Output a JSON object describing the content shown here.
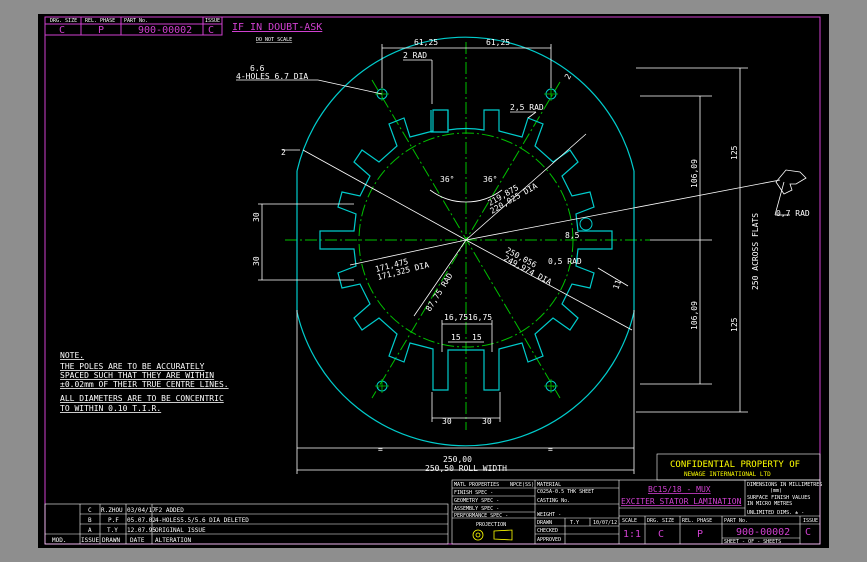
{
  "header": {
    "col_labels": [
      "DRG. SIZE",
      "REL. PHASE",
      "PART No.",
      "ISSUE"
    ],
    "drg_size": "C",
    "rel_phase": "P",
    "part_no": "900-00002",
    "issue": "C",
    "doubt": "IF IN DOUBT-ASK",
    "noscale": "DO NOT SCALE"
  },
  "dims": {
    "w61a": "61,25",
    "w61b": "61,25",
    "rad2_top": "2 RAD",
    "rad2_5": "2,5 RAD",
    "dia66": "6.6",
    "holes": "4-HOLES 6.7 DIA",
    "left2": "2",
    "top2": "2",
    "h30a": "30",
    "h30b": "30",
    "ang36a": "36°",
    "ang36b": "36°",
    "dia219": "219,875",
    "dia220": "220,025 DIA",
    "dia171a": "171,475",
    "dia171b": "171,325 DIA",
    "r87": "87,75 RAD",
    "dia250a": "250,056",
    "dia250b": "249,974 DIA",
    "r85": "8,5",
    "r05": "0,5 RAD",
    "d11": "11",
    "d1675a": "16,75",
    "d1675b": "16,75",
    "d15a": "15",
    "d15b": "15",
    "b30a": "30",
    "b30b": "30",
    "r07": "0,7 RAD",
    "v10609a": "106,09",
    "v10609b": "106,09",
    "v125a": "125",
    "v125b": "125",
    "flats": "250 ACROSS FLATS",
    "width250": "250,00",
    "rollwidth": "250,50 ROLL WIDTH",
    "eq1": "=",
    "eq2": "="
  },
  "notes": {
    "heading": "NOTE.",
    "line1": "THE POLES ARE TO BE ACCURATELY",
    "line2": "SPACED SUCH THAT THEY ARE WITHIN",
    "line3": "±0.02mm OF THEIR TRUE CENTRE LINES.",
    "line4": "ALL DIAMETERS ARE TO BE CONCENTRIC",
    "line5": "TO WITHIN 0.10 T.I.R."
  },
  "revisions": {
    "rows": [
      {
        "issue": "C",
        "drawn": "R.ZHOU",
        "date": "03/04/17",
        "alteration": "F2 ADDED"
      },
      {
        "issue": "B",
        "drawn": "P.F",
        "date": "05.07.02",
        "alteration": "4-HOLES5.5/5.6 DIA DELETED"
      },
      {
        "issue": "A",
        "drawn": "T.Y",
        "date": "12.07.95",
        "alteration": "ORIGINAL ISSUE"
      }
    ],
    "footer": [
      "MOD.",
      "ISSUE",
      "DRAWN",
      "DATE",
      "ALTERATION"
    ]
  },
  "titleblock": {
    "confidential": "CONFIDENTIAL  PROPERTY OF",
    "company": "NEWAGE INTERNATIONAL LTD",
    "matl_props": "MATL PROPERTIES",
    "matl_props_val": "NPCE(SS)",
    "material_label": "MATERIAL",
    "material_val": "C025A-0.5 THK  SHEET",
    "finish": "FINISH SPEC -",
    "casting": "CASTING No.",
    "geometry": "GEOMETRY SPEC -",
    "assembly": "ASSEMBLY SPEC -",
    "performance": "PERFORMANCE SPEC -",
    "weight": "WEIGHT  -",
    "projection": "PROJECTION",
    "drawn_label": "DRAWN",
    "drawn_val": "T.Y",
    "drawn_date": "10/07/12",
    "checked": "CHECKED",
    "approved": "APPROVED",
    "title1": "BC15/18 - MUX",
    "title2": "EXCITER STATOR LAMINATION",
    "units1": "DIMENSIONS IN MILLIMETRES",
    "units2": "(mm)",
    "surface1": "SURFACE FINISH VALUES",
    "surface2": "IN MICRO METRES",
    "unlimited": "UNLIMITED DIMS. ±  -",
    "scale_label": "SCALE",
    "scale_val": "1:1",
    "drg_size_label": "DRG. SIZE",
    "drg_size_val": "C",
    "rel_phase_label": "REL. PHASE",
    "rel_phase_val": "P",
    "part_label": "PART No.",
    "part_val": "900-00002",
    "issue_label": "ISSUE",
    "issue_val": "C",
    "sheet": "SHEET   -   OF   -   SHEETS"
  },
  "colors": {
    "geometry": "#00cccc",
    "centerline": "#00c000",
    "frame": "#d040d0",
    "text": "#ffffff",
    "titleblock": "#ffff00"
  }
}
